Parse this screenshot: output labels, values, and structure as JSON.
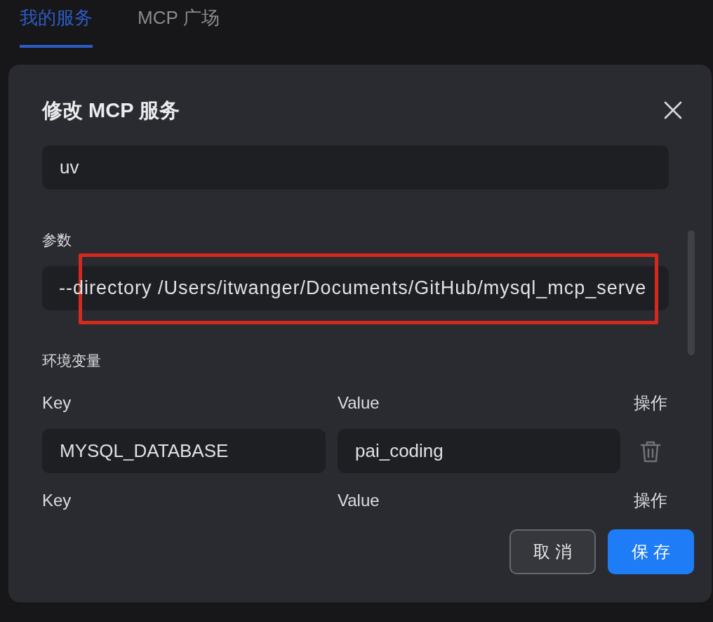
{
  "tabs": [
    {
      "label": "我的服务",
      "selected": true
    },
    {
      "label": "MCP 广场",
      "selected": false
    }
  ],
  "dialog": {
    "title": "修改 MCP 服务",
    "command_field": {
      "value": "uv"
    },
    "args": {
      "label": "参数",
      "value": "--directory /Users/itwanger/Documents/GitHub/mysql_mcp_serve",
      "highlighted": true
    },
    "env": {
      "label": "环境变量",
      "rows": [
        {
          "key_header": "Key",
          "value_header": "Value",
          "action_header": "操作",
          "key": "MYSQL_DATABASE",
          "value": "pai_coding"
        },
        {
          "key_header": "Key",
          "value_header": "Value",
          "action_header": "操作"
        }
      ]
    },
    "buttons": [
      {
        "label": "取 消",
        "kind": "secondary"
      },
      {
        "label": "保 存",
        "kind": "primary"
      }
    ]
  }
}
